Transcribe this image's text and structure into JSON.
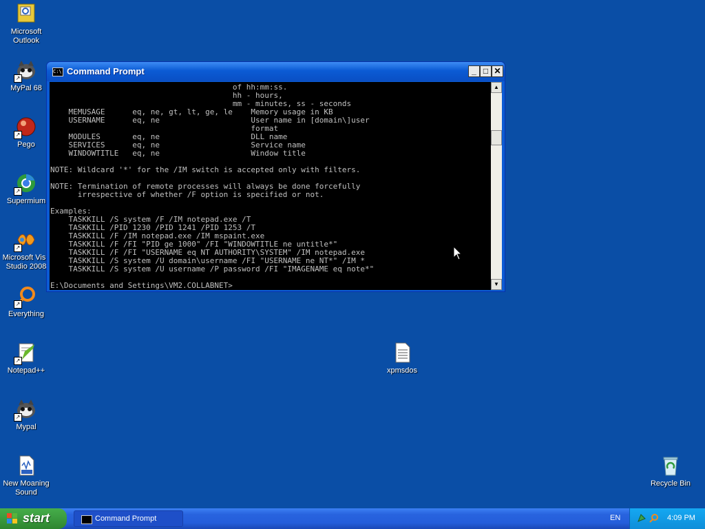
{
  "desktop": {
    "icons": [
      {
        "label": "Microsoft\nOutlook"
      },
      {
        "label": "MyPal 68"
      },
      {
        "label": "Pego"
      },
      {
        "label": "Supermium"
      },
      {
        "label": "Microsoft Visu\nStudio 2008"
      },
      {
        "label": "Everything"
      },
      {
        "label": "Notepad++"
      },
      {
        "label": "Mypal"
      },
      {
        "label": "New Moaning\nSound"
      },
      {
        "label": "xpmsdos"
      },
      {
        "label": "Recycle Bin"
      }
    ]
  },
  "window": {
    "title": "Command Prompt",
    "console_text": "                                        of hh:mm:ss.\n                                        hh - hours,\n                                        mm - minutes, ss - seconds\n    MEMUSAGE      eq, ne, gt, lt, ge, le    Memory usage in KB\n    USERNAME      eq, ne                    User name in [domain\\]user\n                                            format\n    MODULES       eq, ne                    DLL name\n    SERVICES      eq, ne                    Service name\n    WINDOWTITLE   eq, ne                    Window title\n\nNOTE: Wildcard '*' for the /IM switch is accepted only with filters.\n\nNOTE: Termination of remote processes will always be done forcefully\n      irrespective of whether /F option is specified or not.\n\nExamples:\n    TASKKILL /S system /F /IM notepad.exe /T\n    TASKKILL /PID 1230 /PID 1241 /PID 1253 /T\n    TASKKILL /F /IM notepad.exe /IM mspaint.exe\n    TASKKILL /F /FI \"PID ge 1000\" /FI \"WINDOWTITLE ne untitle*\"\n    TASKKILL /F /FI \"USERNAME eq NT AUTHORITY\\SYSTEM\" /IM notepad.exe\n    TASKKILL /S system /U domain\\username /FI \"USERNAME ne NT*\" /IM *\n    TASKKILL /S system /U username /P password /FI \"IMAGENAME eq note*\"\n\nE:\\Documents and Settings\\VM2.COLLABNET>"
  },
  "taskbar": {
    "start_label": "start",
    "tasks": [
      {
        "label": "Command Prompt"
      }
    ],
    "language": "EN",
    "clock": "4:09 PM"
  },
  "colors": {
    "desktop_bg": "#0a4ea6",
    "console_bg": "#000000",
    "console_fg": "#c0c0c0",
    "titlebar": "#0b5bd4",
    "start_green": "#3a9a3e"
  }
}
